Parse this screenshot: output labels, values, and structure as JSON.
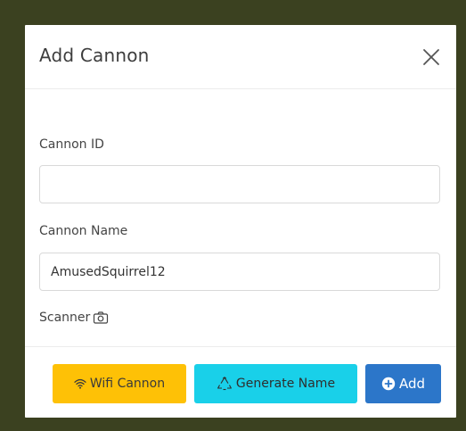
{
  "modal": {
    "title": "Add Cannon",
    "close_icon": "close-icon"
  },
  "form": {
    "cannon_id": {
      "label": "Cannon ID",
      "value": "",
      "placeholder": ""
    },
    "cannon_name": {
      "label": "Cannon Name",
      "value": "AmusedSquirrel12"
    },
    "scanner": {
      "label": "Scanner",
      "icon": "camera-icon"
    }
  },
  "footer": {
    "wifi_label": "Wifi Cannon",
    "wifi_icon": "wifi-icon",
    "generate_label": "Generate Name",
    "generate_icon": "recycle-icon",
    "add_label": "Add",
    "add_icon": "plus-circle-icon"
  },
  "colors": {
    "backdrop": "#3b4120",
    "wifi_button": "#fec106",
    "generate_button": "#19d0e9",
    "add_button": "#2c76c9"
  }
}
